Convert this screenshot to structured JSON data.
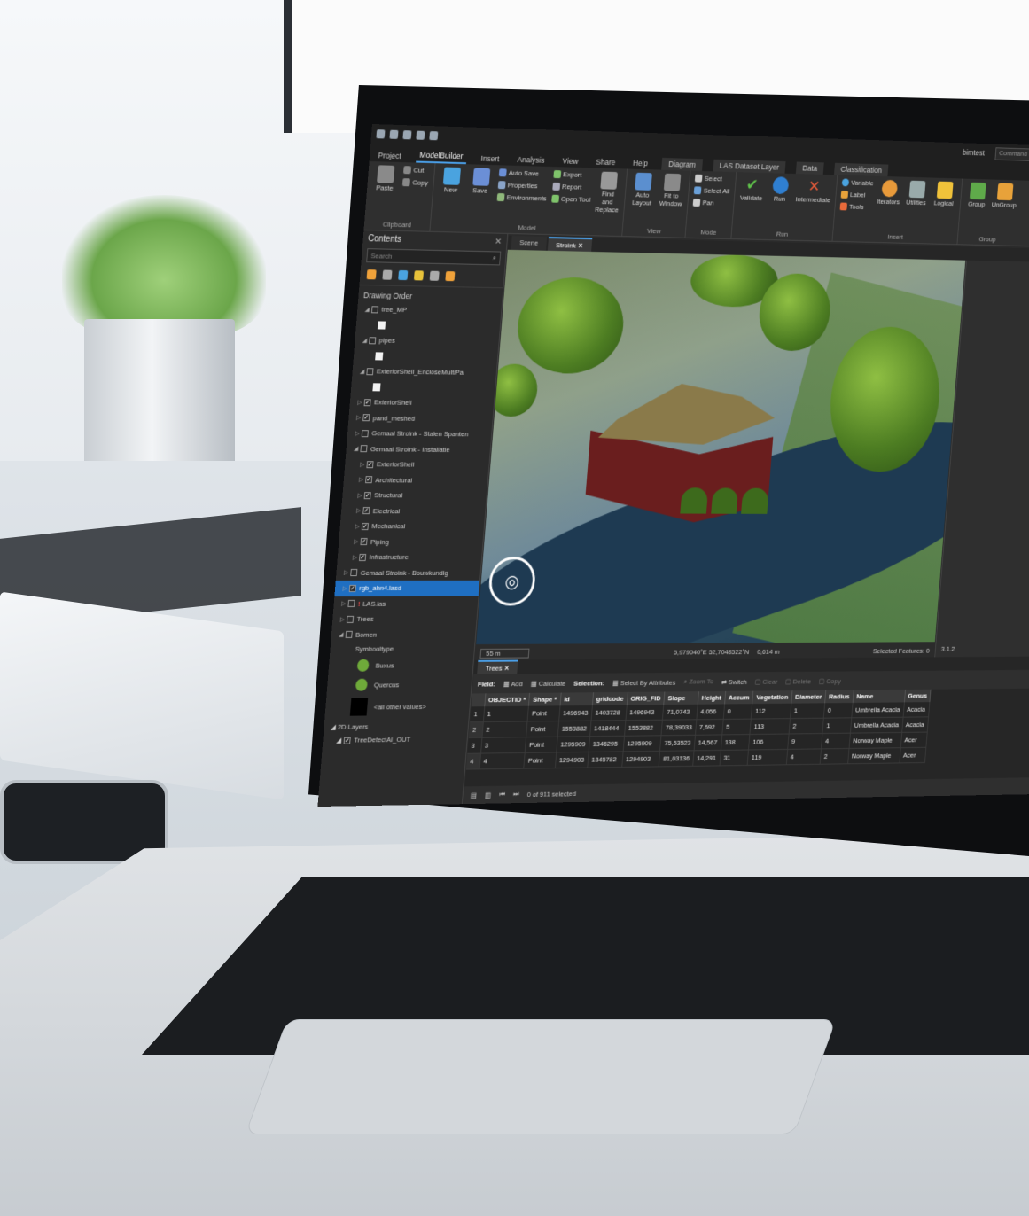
{
  "app": {
    "user": "bimtest",
    "command_search_placeholder": "Command Search (Alt+Q)"
  },
  "ribbon_tabs": [
    {
      "label": "Project"
    },
    {
      "label": "ModelBuilder"
    },
    {
      "label": "Insert"
    },
    {
      "label": "Analysis"
    },
    {
      "label": "View"
    },
    {
      "label": "Share"
    },
    {
      "label": "Help"
    },
    {
      "label": "Diagram"
    },
    {
      "label": "LAS Dataset Layer"
    },
    {
      "label": "Data"
    },
    {
      "label": "Classification"
    }
  ],
  "ribbon": {
    "clipboard": {
      "label": "Clipboard",
      "paste": "Paste",
      "cut": "Cut",
      "copy": "Copy"
    },
    "model": {
      "label": "Model",
      "new": "New",
      "save": "Save",
      "auto_save": "Auto Save",
      "properties": "Properties",
      "environments": "Environments",
      "export": "Export",
      "report": "Report",
      "open_tool": "Open Tool",
      "find_replace": "Find and Replace"
    },
    "view": {
      "label": "View",
      "auto_layout": "Auto Layout",
      "fit_to_window": "Fit to Window"
    },
    "mode": {
      "label": "Mode",
      "select": "Select",
      "select_all": "Select All",
      "pan": "Pan"
    },
    "run": {
      "label": "Run",
      "validate": "Validate",
      "run": "Run",
      "intermediate": "Intermediate"
    },
    "insert": {
      "label": "Insert",
      "variable": "Variable",
      "label_btn": "Label",
      "tools": "Tools",
      "iterators": "Iterators",
      "utilities": "Utilities",
      "logical": "Logical"
    },
    "group": {
      "label": "Group",
      "group": "Group",
      "ungroup": "UnGroup"
    }
  },
  "contents": {
    "title": "Contents",
    "search_placeholder": "Search",
    "drawing_order": "Drawing Order",
    "layers": [
      {
        "name": "tree_MP",
        "checked": false,
        "indent": 1,
        "expand": "◢"
      },
      {
        "name": "",
        "swatch": true,
        "indent": 2
      },
      {
        "name": "pipes",
        "checked": false,
        "indent": 1,
        "expand": "◢"
      },
      {
        "name": "",
        "swatch": true,
        "indent": 2
      },
      {
        "name": "ExteriorShell_EncloseMultiPa",
        "checked": false,
        "indent": 1,
        "expand": "◢"
      },
      {
        "name": "",
        "swatch": true,
        "indent": 2
      },
      {
        "name": "ExteriorShell",
        "checked": true,
        "indent": 1,
        "expand": "▷"
      },
      {
        "name": "pand_meshed",
        "checked": true,
        "indent": 1,
        "expand": "▷"
      },
      {
        "name": "Gemaal Stroink - Stalen Spanten",
        "checked": false,
        "indent": 1,
        "expand": "▷"
      },
      {
        "name": "Gemaal Stroink - Installatie",
        "checked": false,
        "indent": 1,
        "expand": "◢"
      },
      {
        "name": "ExteriorShell",
        "checked": true,
        "indent": 2,
        "expand": "▷"
      },
      {
        "name": "Architectural",
        "checked": true,
        "indent": 2,
        "expand": "▷"
      },
      {
        "name": "Structural",
        "checked": true,
        "indent": 2,
        "expand": "▷"
      },
      {
        "name": "Electrical",
        "checked": true,
        "indent": 2,
        "expand": "▷"
      },
      {
        "name": "Mechanical",
        "checked": true,
        "indent": 2,
        "expand": "▷"
      },
      {
        "name": "Piping",
        "checked": true,
        "indent": 2,
        "expand": "▷"
      },
      {
        "name": "Infrastructure",
        "checked": true,
        "indent": 2,
        "expand": "▷"
      },
      {
        "name": "Gemaal Stroink - Bouwkundig",
        "checked": false,
        "indent": 1,
        "expand": "▷"
      },
      {
        "name": "rgb_ahn4.lasd",
        "checked": true,
        "indent": 1,
        "expand": "▷",
        "selected": true
      },
      {
        "name": "LAS.las",
        "checked": false,
        "indent": 1,
        "expand": "▷",
        "warn": true
      },
      {
        "name": "Trees",
        "checked": false,
        "indent": 1,
        "expand": "▷"
      },
      {
        "name": "Bomen",
        "checked": false,
        "indent": 1,
        "expand": "◢"
      }
    ],
    "symbology_type": "Symbooltype",
    "symbols": [
      "Buxus",
      "Quercus",
      "<all other values>"
    ],
    "layers_2d": "2D Layers",
    "tree_detect": "TreeDetectAI_OUT"
  },
  "views": [
    {
      "label": "Scene",
      "active": false
    },
    {
      "label": "Stroink",
      "active": true
    }
  ],
  "map_status": {
    "scale": "55 m",
    "coords": "5,979040°E 52,7048522°N",
    "elevation": "0,614 m",
    "selected_features": "Selected Features: 0",
    "version": "3.1.2"
  },
  "attribute": {
    "tab": "Trees",
    "field_label": "Field:",
    "add": "Add",
    "calculate": "Calculate",
    "selection_label": "Selection:",
    "select_by_attributes": "Select By Attributes",
    "zoom_to": "Zoom To",
    "switch": "Switch",
    "clear": "Clear",
    "delete": "Delete",
    "copy": "Copy",
    "columns": [
      "OBJECTID *",
      "Shape *",
      "Id",
      "gridcode",
      "ORIG_FID",
      "Slope",
      "Height",
      "Accum",
      "Vegetation",
      "Diameter",
      "Radius",
      "Name",
      "Genus"
    ],
    "rows": [
      [
        "1",
        "Point",
        "1496943",
        "1403728",
        "1496943",
        "71,0743",
        "4,056",
        "0",
        "112",
        "1",
        "0",
        "Umbrella Acacia",
        "Acacia"
      ],
      [
        "2",
        "Point",
        "1553882",
        "1418444",
        "1553882",
        "78,39033",
        "7,692",
        "5",
        "113",
        "2",
        "1",
        "Umbrella Acacia",
        "Acacia"
      ],
      [
        "3",
        "Point",
        "1295909",
        "1346295",
        "1295909",
        "75,53523",
        "14,567",
        "138",
        "106",
        "9",
        "4",
        "Norway Maple",
        "Acer"
      ],
      [
        "4",
        "Point",
        "1294903",
        "1345782",
        "1294903",
        "81,03136",
        "14,291",
        "31",
        "119",
        "4",
        "2",
        "Norway Maple",
        "Acer"
      ]
    ],
    "status": "0 of 911 selected"
  },
  "colors": {
    "accent": "#1f6fc2",
    "ribbon_bg": "#2f2f2f",
    "pane_bg": "#2b2b2b"
  }
}
